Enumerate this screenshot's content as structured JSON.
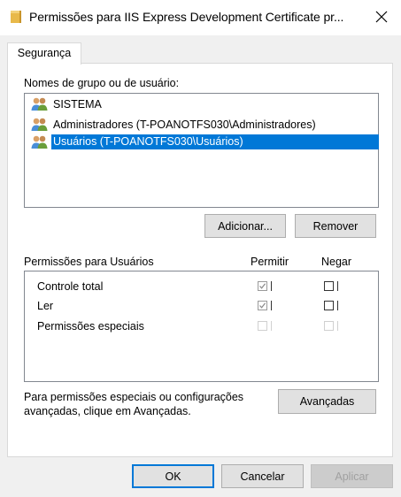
{
  "window": {
    "title": "Permissões para IIS Express Development Certificate pr...",
    "icon": "folder-icon",
    "close_icon": "close-icon"
  },
  "tabs": [
    {
      "label": "Segurança",
      "active": true
    }
  ],
  "users": {
    "label": "Nomes de grupo ou de usuário:",
    "items": [
      {
        "name": "SISTEMA",
        "icon": "users-icon",
        "selected": false
      },
      {
        "name": "Administradores (T-POANOTFS030\\Administradores)",
        "icon": "users-icon",
        "selected": false
      },
      {
        "name": "Usuários (T-POANOTFS030\\Usuários)",
        "icon": "users-icon",
        "selected": true
      }
    ],
    "add_button": "Adicionar...",
    "remove_button": "Remover"
  },
  "permissions": {
    "label": "Permissões para Usuários",
    "allow_header": "Permitir",
    "deny_header": "Negar",
    "rows": [
      {
        "name": "Controle total",
        "allow": true,
        "deny": false,
        "enabled": true
      },
      {
        "name": "Ler",
        "allow": true,
        "deny": false,
        "enabled": true
      },
      {
        "name": "Permissões especiais",
        "allow": false,
        "deny": false,
        "enabled": false
      }
    ]
  },
  "advanced": {
    "text_line1": "Para permissões especiais ou configurações",
    "text_line2": "avançadas, clique em Avançadas.",
    "button": "Avançadas"
  },
  "footer": {
    "ok": "OK",
    "cancel": "Cancelar",
    "apply": "Aplicar"
  },
  "colors": {
    "selection": "#0078d7",
    "dialog_bg": "#f0f0f0",
    "button_bg": "#e1e1e1"
  }
}
